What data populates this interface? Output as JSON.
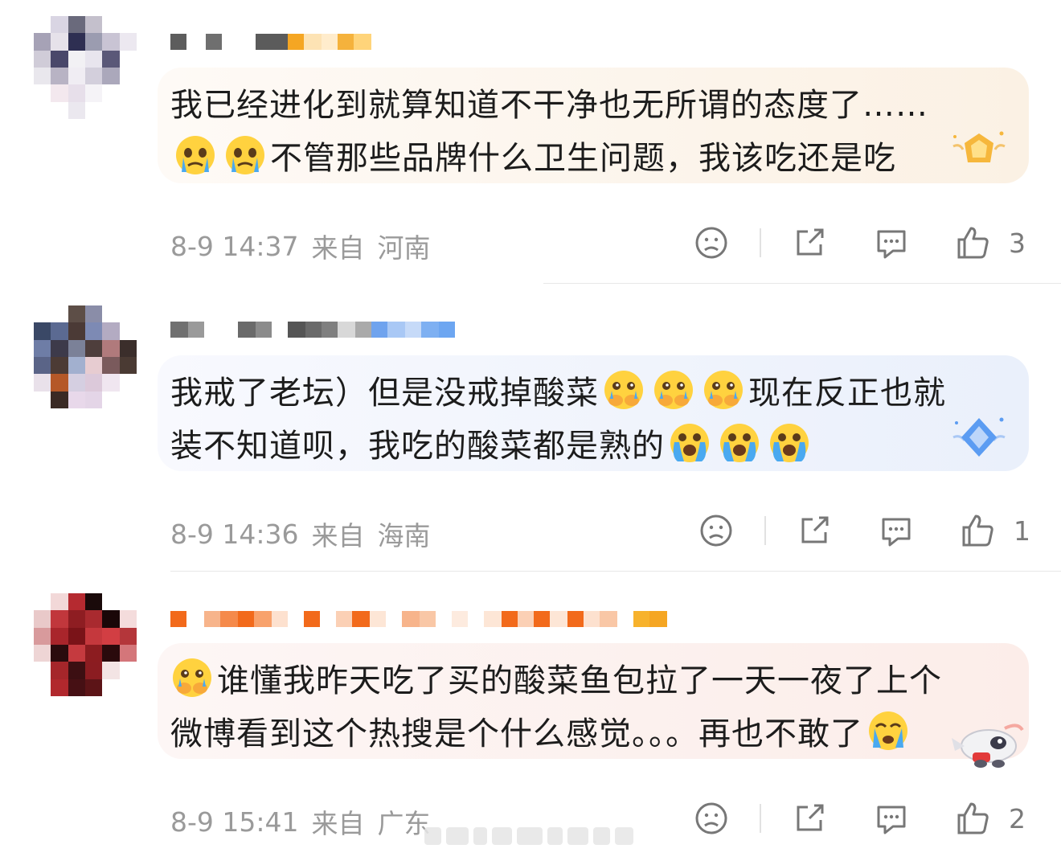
{
  "comments": [
    {
      "text_line1": "我已经进化到就算知道不干净也无所谓的态度了……",
      "text_line2": "不管那些品牌什么卫生问题，我该吃还是吃",
      "line2_emojis": [
        "crying-face-icon",
        "crying-face-icon"
      ],
      "time": "8-9 14:37",
      "from_label": "来自",
      "location": "河南",
      "like_count": "3",
      "badge": "gold-star-badge",
      "bubble_color": "#fbf3ea"
    },
    {
      "text_line1": "我戒了老坛）但是没戒掉酸菜",
      "line1_emojis": [
        "covering-mouth-crying-icon",
        "covering-mouth-crying-icon",
        "covering-mouth-crying-icon"
      ],
      "text_line1b": "现在反正也就",
      "text_line2": "装不知道呗，我吃的酸菜都是熟的",
      "line2_emojis": [
        "loudly-crying-icon",
        "loudly-crying-icon",
        "loudly-crying-icon"
      ],
      "time": "8-9 14:36",
      "from_label": "来自",
      "location": "海南",
      "like_count": "1",
      "badge": "blue-diamond-badge",
      "bubble_color": "#eef3fc"
    },
    {
      "text_line1": "谁懂我昨天吃了买的酸菜鱼包拉了一天一夜了上个",
      "line1_emoji": "covering-mouth-crying-icon",
      "text_line2": "微博看到这个热搜是个什么感觉。。。再也不敢了",
      "line2_emoji": "crying-face-icon",
      "time": "8-9 15:41",
      "from_label": "来自",
      "location": "广东",
      "like_count": "2",
      "badge": "plane-mascot-badge",
      "bubble_color": "#fcf0ee"
    }
  ],
  "icons": {
    "dislike": "sad-face-icon",
    "share": "share-icon",
    "comment": "comment-icon",
    "like": "thumbs-up-icon"
  },
  "colors": {
    "meta_text": "#9a9a9a",
    "gold_badge": "#f6b73c",
    "blue_badge": "#5b9cf2"
  }
}
